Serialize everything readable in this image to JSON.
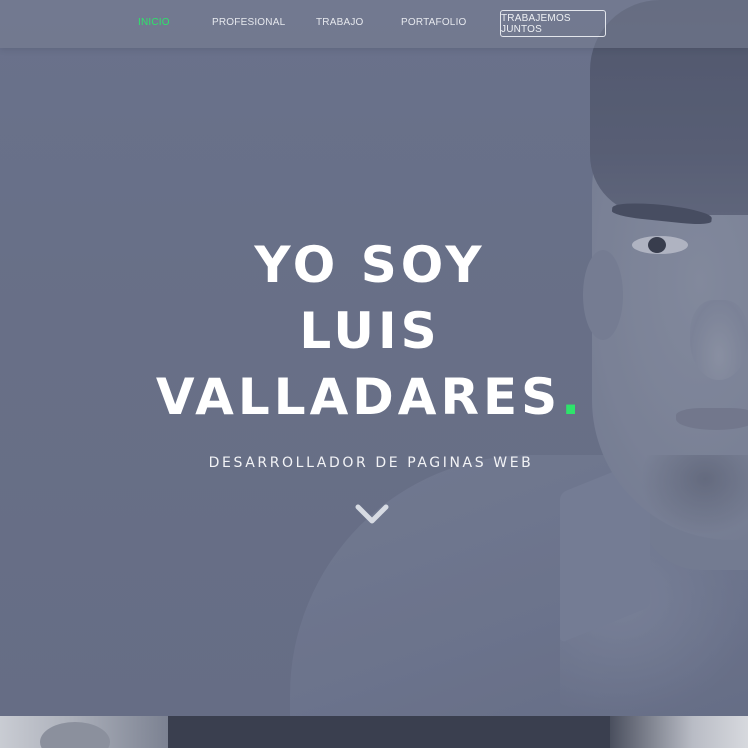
{
  "nav": {
    "items": [
      {
        "label": "INICIO",
        "active": true
      },
      {
        "label": "PROFESIONAL",
        "active": false
      },
      {
        "label": "TRABAJO",
        "active": false
      },
      {
        "label": "PORTAFOLIO",
        "active": false
      }
    ],
    "cta_label": "TRABAJEMOS JUNTOS"
  },
  "hero": {
    "title_lines": [
      "YO SOY",
      "LUIS",
      "VALLADARES"
    ],
    "title_dot": ".",
    "subtitle": "DESARROLLADOR DE PAGINAS WEB",
    "scroll_icon": "chevron-down-icon"
  },
  "colors": {
    "accent": "#2ee36b",
    "overlay": "#6b7389",
    "text": "#ffffff"
  }
}
